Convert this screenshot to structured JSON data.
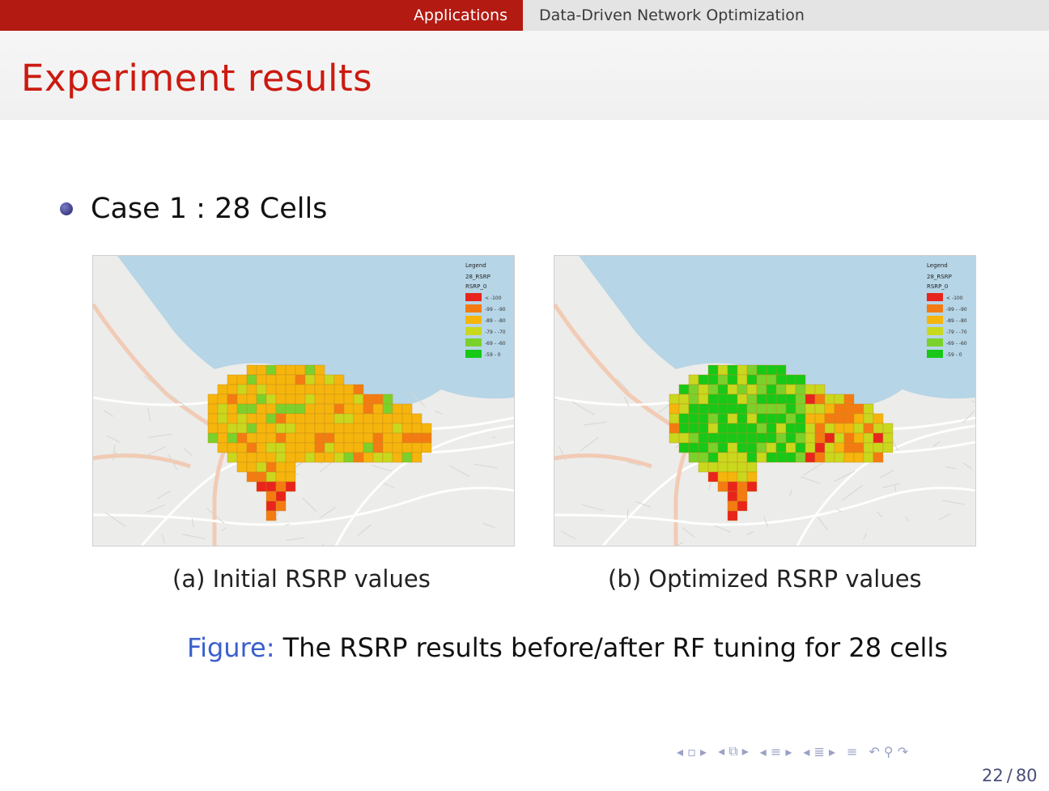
{
  "header": {
    "section": "Applications",
    "subsection": "Data-Driven Network Optimization"
  },
  "slide": {
    "title": "Experiment results",
    "bullet": "Case 1 : 28 Cells"
  },
  "figures": [
    {
      "id": "a",
      "caption": "(a) Initial RSRP values"
    },
    {
      "id": "b",
      "caption": "(b) Optimized RSRP values"
    }
  ],
  "figure_caption": {
    "label": "Figure:",
    "text": "The RSRP results before/after RF tuning for 28 cells"
  },
  "legend": {
    "title": "Legend",
    "layer": "28_RSRP",
    "field": "RSRP_0",
    "classes": [
      "< -100",
      "-99 - -90",
      "-89 - -80",
      "-79 - -70",
      "-69 - -60",
      "-59 - 0"
    ]
  },
  "colors": {
    "rsrp_very_bad": "#e8241c",
    "rsrp_bad": "#f47b12",
    "rsrp_fair": "#f5b50c",
    "rsrp_ok": "#c9d81d",
    "rsrp_good": "#7bd12b",
    "rsrp_excellent": "#17c817",
    "sea": "#b6d5e6",
    "land": "#ececea",
    "accent_red": "#b21a12"
  },
  "navigation": {
    "current_page": "22",
    "total_pages": "80"
  }
}
